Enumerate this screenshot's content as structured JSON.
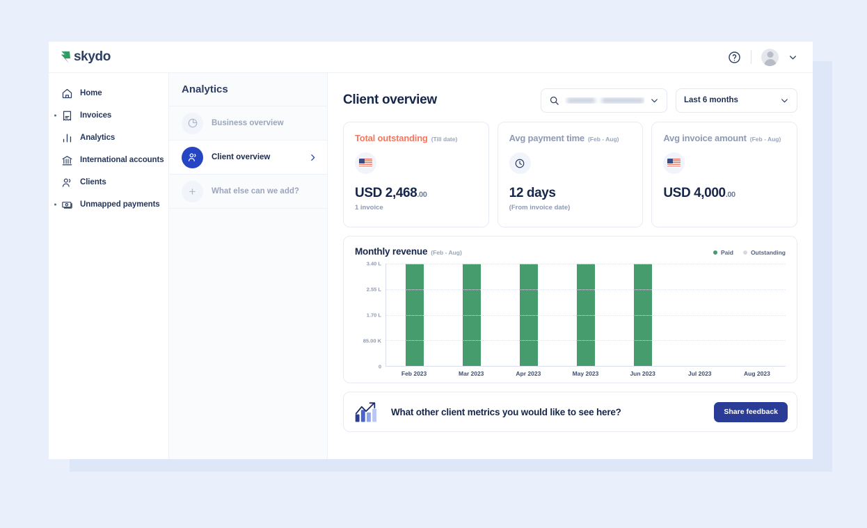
{
  "brand": {
    "name": "skydo",
    "accent_blue": "#2545c4",
    "logo_green": "#2f9e63"
  },
  "topbar": {
    "help_icon": "help-circle-icon",
    "avatar_icon": "user-avatar",
    "caret_icon": "chevron-down-icon"
  },
  "sidebar": {
    "items": [
      {
        "label": "Home",
        "icon": "home-icon",
        "has_marker": false
      },
      {
        "label": "Invoices",
        "icon": "invoice-icon",
        "has_marker": true
      },
      {
        "label": "Analytics",
        "icon": "bar-chart-icon",
        "has_marker": false
      },
      {
        "label": "International accounts",
        "icon": "bank-icon",
        "has_marker": false
      },
      {
        "label": "Clients",
        "icon": "people-icon",
        "has_marker": false
      },
      {
        "label": "Unmapped payments",
        "icon": "banknote-icon",
        "has_marker": true
      }
    ]
  },
  "subnav": {
    "title": "Analytics",
    "items": [
      {
        "label": "Business overview",
        "icon": "pie-chart-icon",
        "active": false,
        "chevron": false
      },
      {
        "label": "Client overview",
        "icon": "people-icon",
        "active": true,
        "chevron": true
      },
      {
        "label": "What else can we add?",
        "icon": "plus-icon",
        "active": false,
        "chevron": false
      }
    ]
  },
  "main": {
    "page_title": "Client overview",
    "search": {
      "placeholder": "Search client",
      "value": "",
      "redacted": true,
      "icon": "search-icon"
    },
    "range": {
      "value": "Last 6 months",
      "icon": "chevron-down-icon"
    }
  },
  "stats": [
    {
      "title": "Total outstanding",
      "period": "(Till date)",
      "alert": true,
      "badge": "us-flag-icon",
      "value": "USD 2,468",
      "cents": ".00",
      "sub": "1 invoice"
    },
    {
      "title": "Avg payment time",
      "period": "(Feb - Aug)",
      "alert": false,
      "badge": "clock-icon",
      "value": "12 days",
      "cents": "",
      "sub": "(From invoice date)"
    },
    {
      "title": "Avg invoice amount",
      "period": "(Feb - Aug)",
      "alert": false,
      "badge": "us-flag-icon",
      "value": "USD 4,000",
      "cents": ".00",
      "sub": ""
    }
  ],
  "chart_data": {
    "type": "bar",
    "title": "Monthly revenue",
    "subtitle": "(Feb - Aug)",
    "xlabel": "",
    "ylabel": "",
    "categories": [
      "Feb 2023",
      "Mar 2023",
      "Apr 2023",
      "May 2023",
      "Jun 2023",
      "Jul 2023",
      "Aug 2023"
    ],
    "ytick_labels": [
      "3.40 L",
      "2.55 L",
      "1.70 L",
      "85.00 K",
      "0"
    ],
    "ytick_values": [
      340000,
      255000,
      170000,
      85000,
      0
    ],
    "ylim": [
      0,
      340000
    ],
    "grid": true,
    "legend_position": "top-right",
    "series": [
      {
        "name": "Paid",
        "color": "#469c6d",
        "values": [
          340000,
          340000,
          340000,
          340000,
          340000,
          0,
          0
        ]
      },
      {
        "name": "Outstanding",
        "color": "#d3d9e3",
        "values": [
          0,
          0,
          0,
          0,
          0,
          0,
          0
        ]
      }
    ]
  },
  "feedback": {
    "icon": "growth-chart-icon",
    "text": "What other client metrics you would like to see here?",
    "button_label": "Share feedback"
  }
}
